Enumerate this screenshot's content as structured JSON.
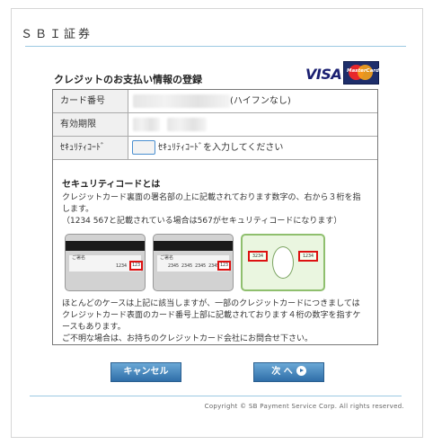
{
  "header": {
    "brand": "ＳＢＩ証券"
  },
  "form": {
    "title": "クレジットのお支払い情報の登録",
    "logos": {
      "visa": "VISA",
      "mastercard": "MasterCard"
    },
    "rows": [
      {
        "label": "カード番号",
        "note": "(ハイフンなし)"
      },
      {
        "label": "有効期限",
        "note": ""
      },
      {
        "label": "ｾｷｭﾘﾃｨｺｰﾄﾞ",
        "note": "ｾｷｭﾘﾃｨｺｰﾄﾞを入力してください"
      }
    ],
    "security": {
      "title": "セキュリティコードとは",
      "line1": "クレジットカード裏面の署名部の上に記載されております数字の、右から３桁を指",
      "line2": "します。",
      "line3": "（1234 567と記載されている場合は567がセキュリティコードになります）",
      "card1": {
        "sig_label": "ご署名",
        "number": "1234",
        "code": "123"
      },
      "card2": {
        "sig_label": "ご署名",
        "number": "2345 2345 2345 2345",
        "code": "123"
      },
      "card3": {
        "left_code": "3234",
        "right_code": "1234"
      },
      "note1": "ほとんどのケースは上記に該当しますが、一部のクレジットカードにつきましては",
      "note2": "クレジットカード表面のカード番号上部に記載されております４桁の数字を指すケ",
      "note3": "ースもあります。",
      "note4": "ご不明な場合は、お持ちのクレジットカード会社にお問合せ下さい。"
    }
  },
  "buttons": {
    "cancel": "キャンセル",
    "next": "次 へ"
  },
  "footer": {
    "copyright": "Copyright © SB Payment Service Corp. All rights reserved."
  },
  "colors": {
    "button": "#2f6ea8",
    "rule": "#9cc9e2",
    "code_box": "#dd1111"
  }
}
